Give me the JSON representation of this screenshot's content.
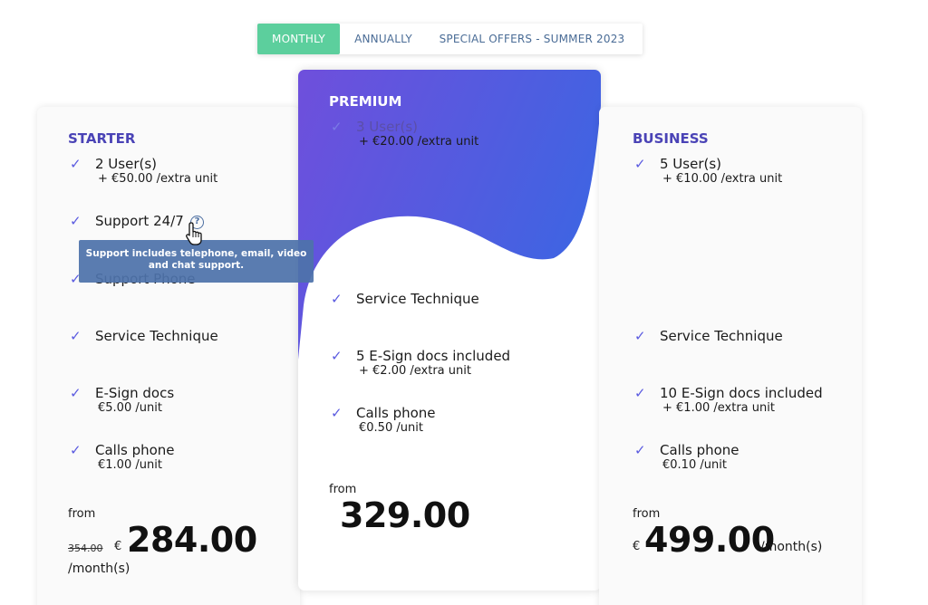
{
  "tabs": [
    {
      "label": "MONTHLY",
      "active": true
    },
    {
      "label": "ANNUALLY",
      "active": false
    },
    {
      "label": "SPECIAL OFFERS - SUMMER 2023",
      "active": false
    }
  ],
  "colors": {
    "accent_green": "#5ccf9d",
    "brand_purple": "#4a43b6",
    "premium_gradient_start": "#6f4fdc",
    "premium_gradient_end": "#3f64e2",
    "tooltip_bg": "#4d72aa"
  },
  "check_symbol": "✓",
  "starter": {
    "name": "STARTER",
    "users": {
      "label": "2 User(s)",
      "sub": "+ €50.00 /extra unit"
    },
    "support": {
      "label": "Support 24/7",
      "info_icon": "?"
    },
    "support_phone": {
      "label": "Support Phone"
    },
    "service": {
      "label": "Service Technique"
    },
    "esign": {
      "label": "E-Sign docs",
      "sub": "€5.00 /unit"
    },
    "calls": {
      "label": "Calls phone",
      "sub": "€1.00 /unit"
    },
    "from": "from",
    "old_price": "354.00",
    "currency": "€",
    "price": "284.00",
    "period": "/month(s)"
  },
  "tooltip": {
    "line1": "Support includes telephone, email, video",
    "line2": "and chat support."
  },
  "premium": {
    "name": "PREMIUM",
    "users": {
      "label": "3 User(s)",
      "sub": "+ €20.00 /extra unit"
    },
    "service": {
      "label": "Service Technique"
    },
    "esign": {
      "label": "5 E-Sign docs included",
      "sub": "+ €2.00 /extra unit"
    },
    "calls": {
      "label": "Calls phone",
      "sub": "€0.50 /unit"
    },
    "from": "from",
    "price": "329.00"
  },
  "business": {
    "name": "BUSINESS",
    "users": {
      "label": "5 User(s)",
      "sub": "+ €10.00 /extra unit"
    },
    "service": {
      "label": "Service Technique"
    },
    "esign": {
      "label": "10 E-Sign docs included",
      "sub": "+ €1.00 /extra unit"
    },
    "calls": {
      "label": "Calls phone",
      "sub": "€0.10 /unit"
    },
    "from": "from",
    "currency": "€",
    "price": "499.00",
    "period": "/month(s)"
  }
}
